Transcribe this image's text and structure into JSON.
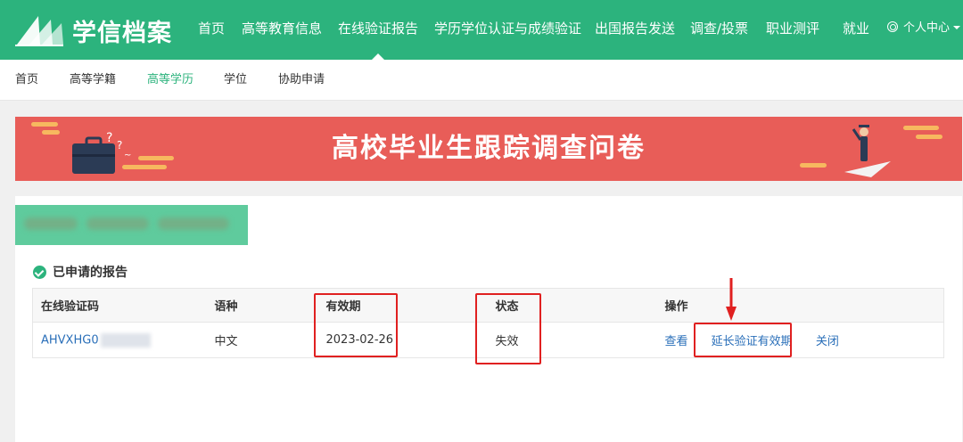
{
  "header": {
    "logo_text": "学信档案",
    "nav": [
      {
        "label": "首页",
        "active": false
      },
      {
        "label": "高等教育信息",
        "active": false
      },
      {
        "label": "在线验证报告",
        "active": true
      },
      {
        "label": "学历学位认证与成绩验证",
        "active": false
      },
      {
        "label": "出国报告发送",
        "active": false
      },
      {
        "label": "调查/投票",
        "active": false
      },
      {
        "label": "职业测评",
        "active": false
      },
      {
        "label": "就业",
        "active": false
      }
    ],
    "user_menu": "个人中心"
  },
  "subnav": [
    {
      "label": "首页",
      "active": false
    },
    {
      "label": "高等学籍",
      "active": false
    },
    {
      "label": "高等学历",
      "active": true
    },
    {
      "label": "学位",
      "active": false
    },
    {
      "label": "协助申请",
      "active": false
    }
  ],
  "banner": {
    "title": "高校毕业生跟踪调查问卷"
  },
  "reports": {
    "section_title": "已申请的报告",
    "columns": [
      "在线验证码",
      "语种",
      "有效期",
      "状态",
      "操作"
    ],
    "rows": [
      {
        "code": "AHVXHG0",
        "language": "中文",
        "expiry": "2023-02-26",
        "status": "失效",
        "actions": [
          "查看",
          "延长验证有效期",
          "关闭"
        ]
      }
    ]
  },
  "colors": {
    "brand_green": "#2cb37d",
    "banner_red": "#e85d58",
    "link_blue": "#2a6fb9",
    "annotation_red": "#e02020"
  }
}
